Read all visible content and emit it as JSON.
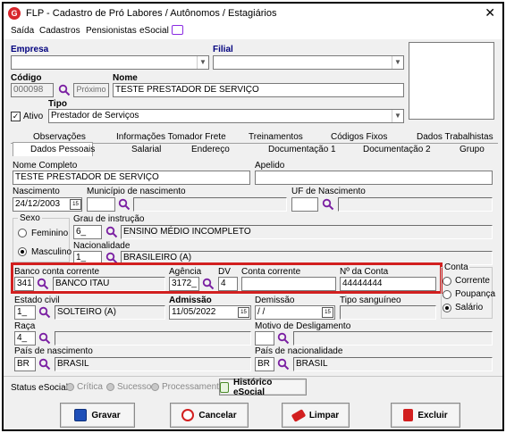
{
  "window": {
    "title": "FLP - Cadastro de Pró Labores / Autônomos / Estagiários",
    "close": "✕",
    "logo": "G"
  },
  "menu": [
    "Saída",
    "Cadastros",
    "Pensionistas",
    "eSocial"
  ],
  "header": {
    "empresa_label": "Empresa",
    "filial_label": "Filial",
    "codigo_label": "Código",
    "codigo_value": "000098",
    "proximo_label": "Próximo",
    "nome_label": "Nome",
    "nome_value": "TESTE PRESTADOR DE SERVIÇO",
    "tipo_label": "Tipo",
    "ativo_label": "Ativo",
    "ativo_checked": "✓",
    "tipo_value": "Prestador de Serviços"
  },
  "tabs": {
    "row1": [
      "Observações",
      "Informações Tomador Frete",
      "Treinamentos",
      "Códigos Fixos",
      "Dados Trabalhistas"
    ],
    "row2": [
      "Dados Pessoais",
      "Salarial",
      "Endereço",
      "Documentação 1",
      "Documentação 2",
      "Grupo"
    ]
  },
  "form": {
    "nome_completo_label": "Nome Completo",
    "nome_completo_value": "TESTE PRESTADOR DE SERVIÇO",
    "apelido_label": "Apelido",
    "nascimento_label": "Nascimento",
    "nascimento_value": "24/12/2003",
    "municipio_label": "Município de nascimento",
    "uf_label": "UF de Nascimento",
    "sexo_label": "Sexo",
    "feminino_label": "Feminino",
    "masculino_label": "Masculino",
    "grau_label": "Grau de instrução",
    "grau_code": "6_",
    "grau_value": "ENSINO MÉDIO INCOMPLETO",
    "nacionalidade_label": "Nacionalidade",
    "nac_code": "1_",
    "nac_value": "BRASILEIRO (A)",
    "banco_label": "Banco conta corrente",
    "banco_code": "341",
    "banco_value": "BANCO ITAU",
    "agencia_label": "Agência",
    "agencia_value": "3172_",
    "dv_label": "DV",
    "dv_value": "4",
    "conta_corrente_label": "Conta corrente",
    "num_conta_label": "Nº da Conta",
    "num_conta_value": "44444444",
    "conta_group_label": "Conta",
    "corrente_label": "Corrente",
    "poupanca_label": "Poupança",
    "salario_label": "Salário",
    "estado_civil_label": "Estado civil",
    "estado_civil_code": "1_",
    "estado_civil_value": "SOLTEIRO (A)",
    "admissao_label": "Admissão",
    "admissao_value": "11/05/2022",
    "demissao_label": "Demissão",
    "demissao_value": " / /",
    "tipo_sang_label": "Tipo sanguíneo",
    "raca_label": "Raça",
    "raca_code": "4_",
    "motivo_label": "Motivo de Desligamento",
    "pais_nasc_label": "País de nascimento",
    "pais_nasc_code": "BR",
    "pais_nasc_value": "BRASIL",
    "pais_nac_label": "País de nacionalidade",
    "pais_nac_code": "BR",
    "pais_nac_value": "BRASIL"
  },
  "status": {
    "label": "Status eSocial:",
    "items": [
      "Crítica",
      "Sucesso",
      "Processamento"
    ],
    "historico": "Histórico eSocial"
  },
  "buttons": {
    "gravar": "Gravar",
    "cancelar": "Cancelar",
    "limpar": "Limpar",
    "excluir": "Excluir"
  },
  "colors": {
    "accent": "#00007e",
    "highlight": "#d21f1f",
    "magnifier": "#7a1fa2"
  }
}
